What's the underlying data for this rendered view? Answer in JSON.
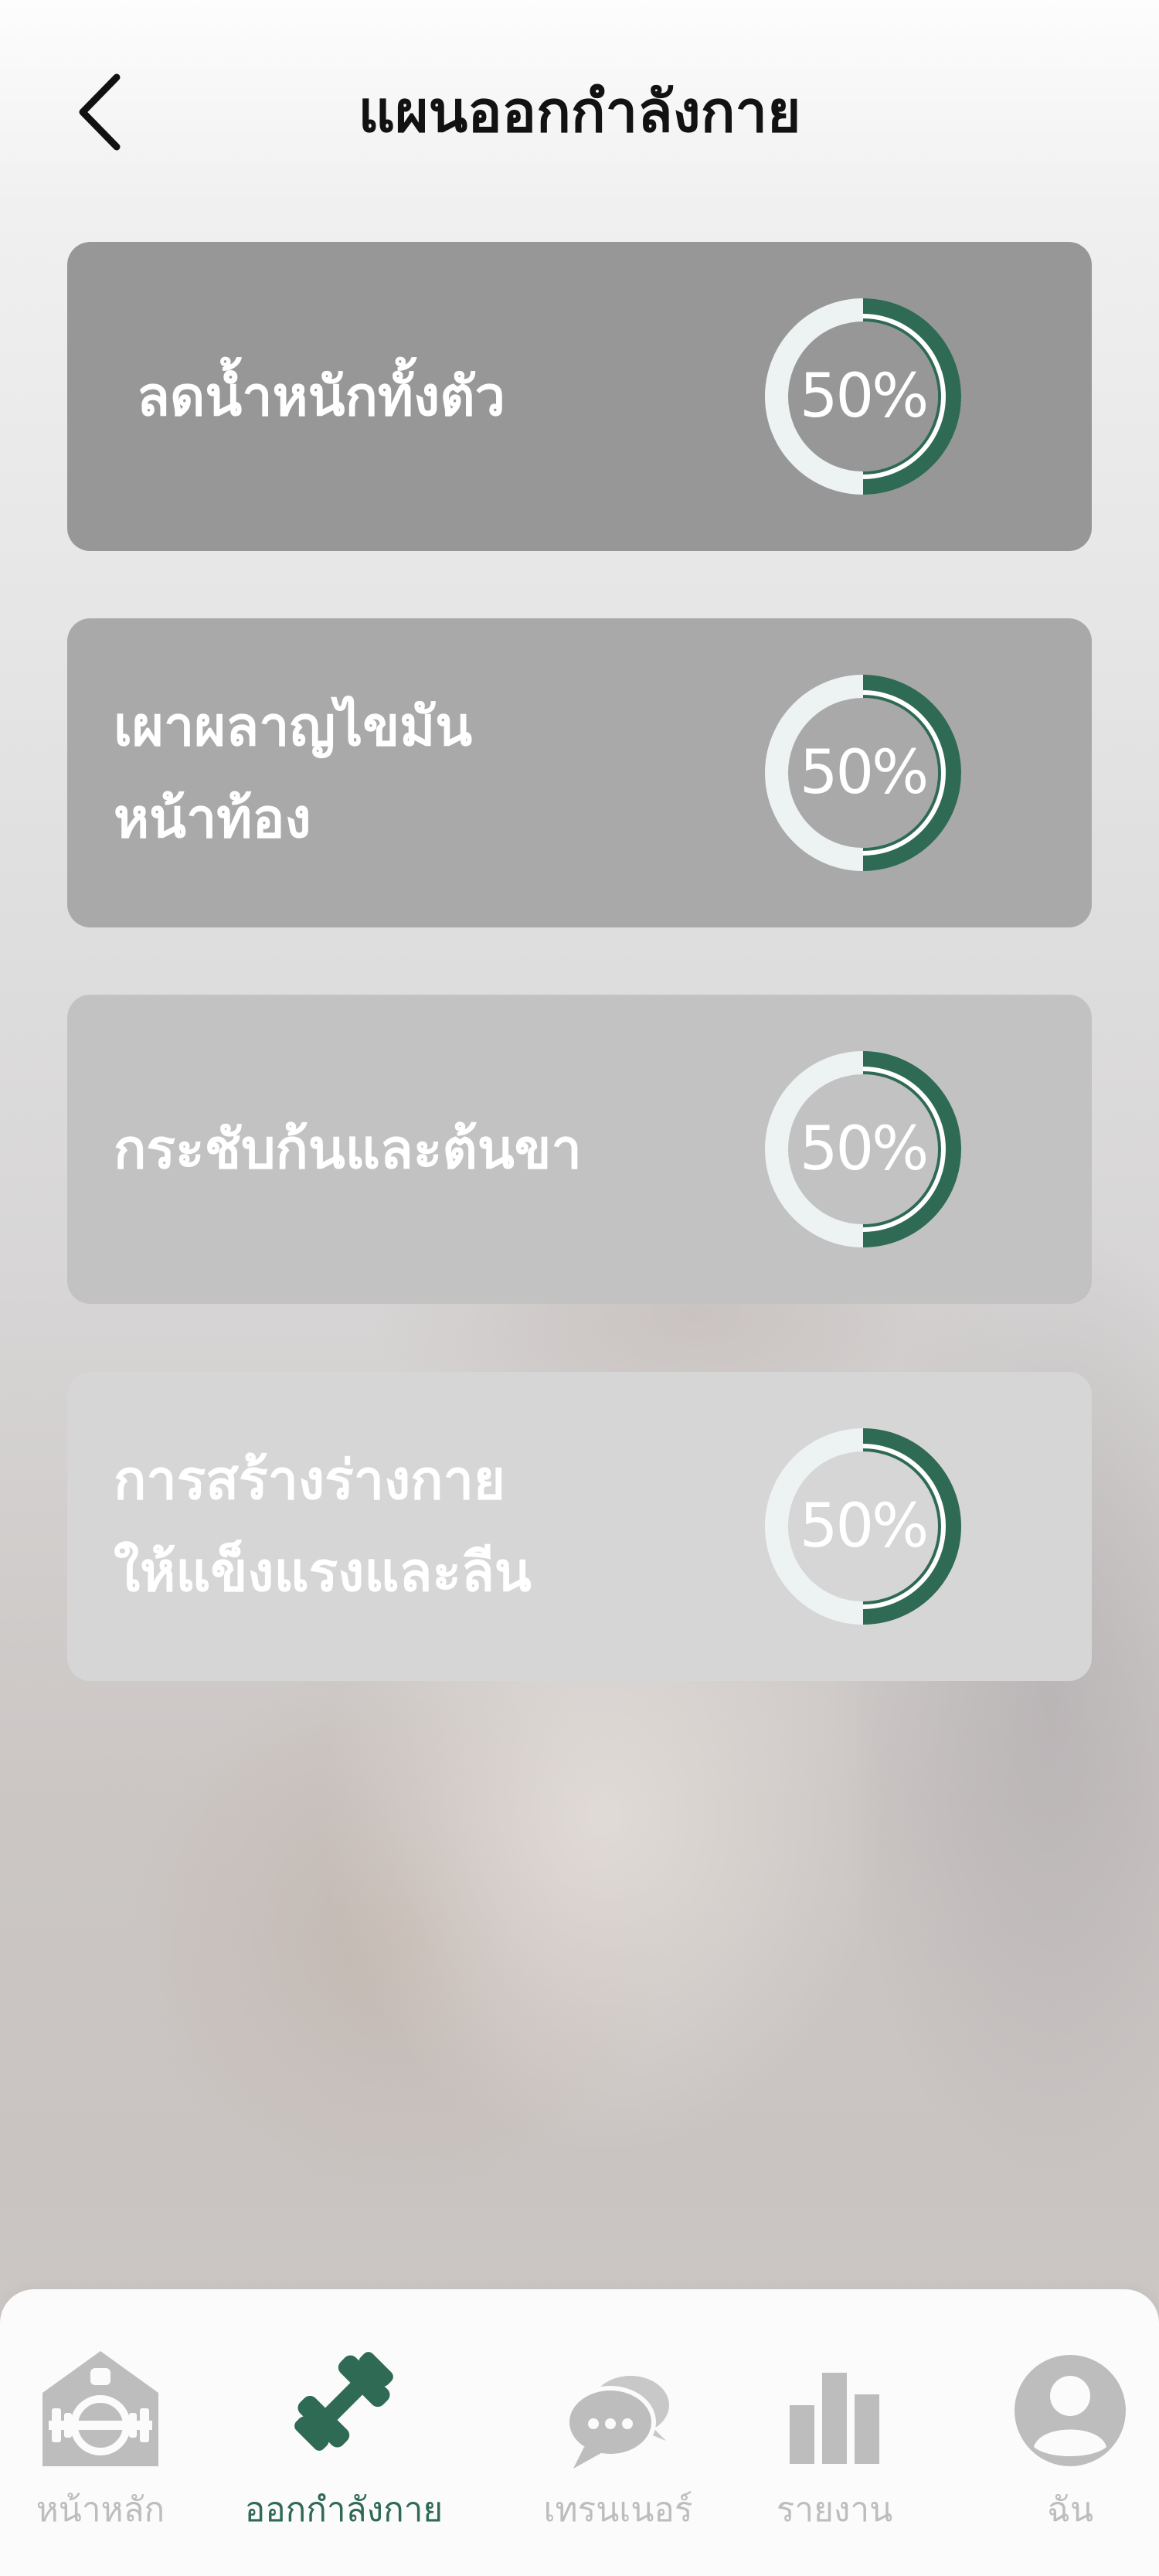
{
  "header": {
    "title": "แผนออกกำลังกาย"
  },
  "plans": [
    {
      "title": "ลดน้ำหนักทั้งตัว",
      "progress": 50,
      "progress_label": "50%"
    },
    {
      "title": "เผาผลาญไขมัน\nหน้าท้อง",
      "progress": 50,
      "progress_label": "50%"
    },
    {
      "title": "กระชับก้นและต้นขา",
      "progress": 50,
      "progress_label": "50%"
    },
    {
      "title": "การสร้างร่างกาย\nให้แข็งแรงและลีน",
      "progress": 50,
      "progress_label": "50%"
    }
  ],
  "tabs": [
    {
      "label": "หน้าหลัก",
      "icon": "home-gym-icon",
      "active": false
    },
    {
      "label": "ออกกำลังกาย",
      "icon": "dumbbell-icon",
      "active": true
    },
    {
      "label": "เทรนเนอร์",
      "icon": "chat-icon",
      "active": false
    },
    {
      "label": "รายงาน",
      "icon": "bar-chart-icon",
      "active": false
    },
    {
      "label": "ฉัน",
      "icon": "user-icon",
      "active": false
    }
  ],
  "colors": {
    "accent": "#2f6a55",
    "ring_track": "#edf2f3",
    "inactive": "#bdbdbd",
    "card_backgrounds": [
      "#979797",
      "#a9a9a9",
      "#c2c2c2",
      "#d6d6d6"
    ]
  }
}
